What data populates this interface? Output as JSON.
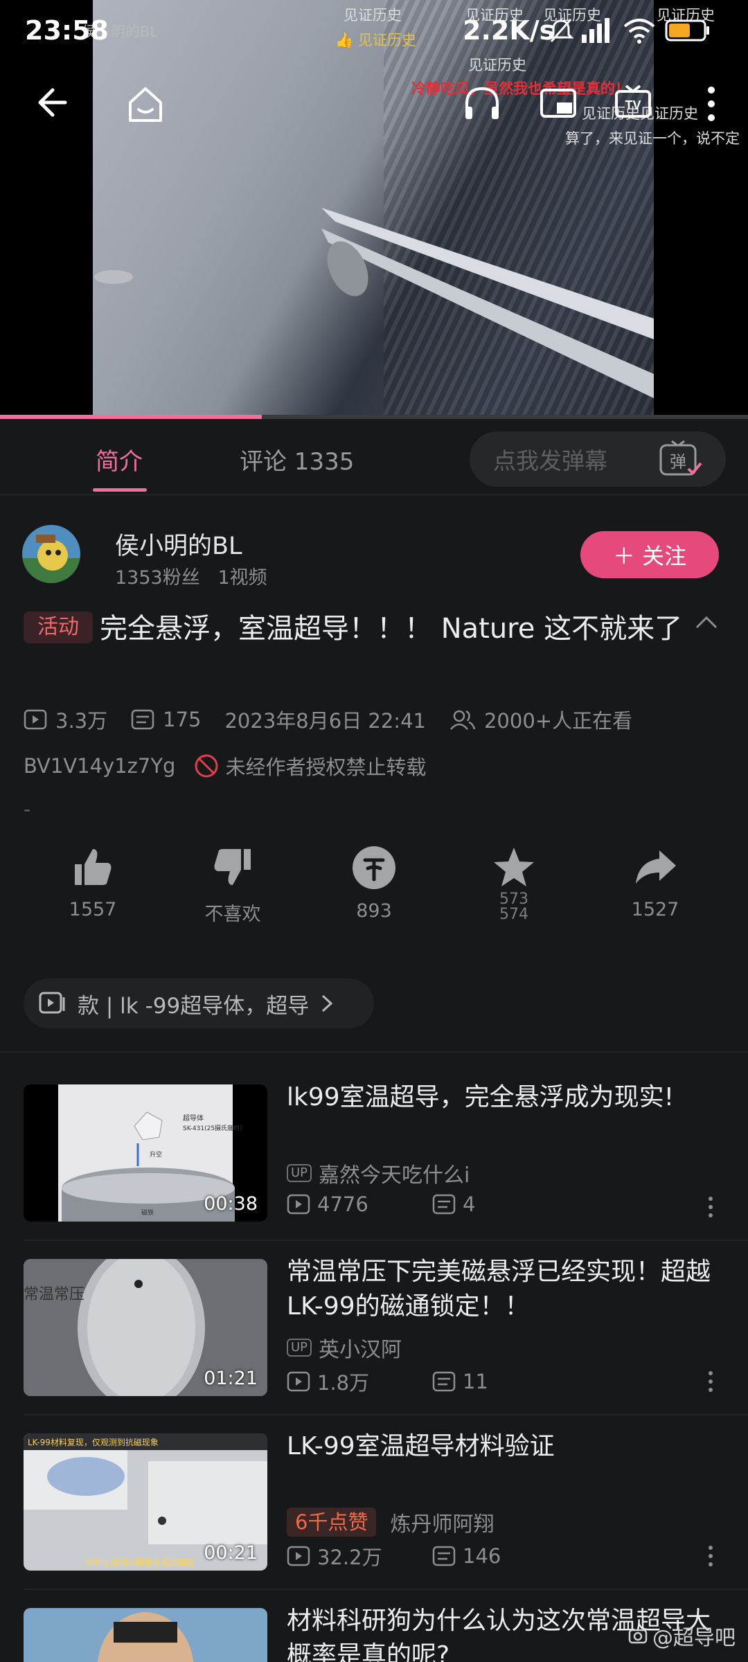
{
  "status_bar": {
    "time": "23:58",
    "network_speed": "2.2K/s"
  },
  "player": {
    "overlay_channel": "侯小明的BL",
    "danmaku": [
      "见证历史",
      "见证历史",
      "见证历史",
      "见证历史",
      "见证历史",
      "见证历史",
      "冷静吃瓜，虽然我也希望是真的！",
      "见证历史见证历史",
      "算了，来见证一个，说不定"
    ],
    "danmaku_liked": "见证历史",
    "progress": 0.35
  },
  "tabs": {
    "intro": "简介",
    "comments": "评论 1335",
    "danmu_placeholder": "点我发弹幕",
    "danmu_switch": "弹"
  },
  "author": {
    "name": "侯小明的BL",
    "fans": "1353粉丝",
    "videos": "1视频",
    "follow": "＋ 关注"
  },
  "video": {
    "tag": "活动",
    "title": "完全悬浮，室温超导！！！ Nature 这不就来了",
    "views": "3.3万",
    "danmaku_count": "175",
    "date": "2023年8月6日 22:41",
    "watching": "2000+人正在看",
    "bvid": "BV1V14y1z7Yg",
    "copyright": "未经作者授权禁止转载",
    "desc": "-"
  },
  "actions": {
    "like": "1557",
    "dislike": "不喜欢",
    "coin": "893",
    "fav_top": "573",
    "fav_bottom": "574",
    "share": "1527"
  },
  "collection": {
    "text": "款 | lk -99超导体，超导"
  },
  "related": [
    {
      "title": "lk99室温超导，完全悬浮成为现实!",
      "up": "嘉然今天吃什么i",
      "views": "4776",
      "danmaku": "4",
      "duration": "00:38"
    },
    {
      "title": "常温常压下完美磁悬浮已经实现！超越LK-99的磁通锁定！！",
      "up": "英小汉阿",
      "views": "1.8万",
      "danmaku": "11",
      "duration": "01:21"
    },
    {
      "title": "LK-99室温超导材料验证",
      "badge": "6千点赞",
      "up": "炼丹师阿翔",
      "views": "32.2万",
      "danmaku": "146",
      "duration": "00:21"
    },
    {
      "title": "材料科研狗为什么认为这次常温超导大概率是真的呢?"
    }
  ],
  "thumb_texts": {
    "t1_a": "超导体",
    "t1_b": "SK-431(25摄氏度时)",
    "t1_c": "升空",
    "t1_d": "磁铁",
    "t2": "常温常压",
    "t3_a": "LK-99材料复现，仅观测到抗磁现象",
    "t3_b": "材料太过细小摄像头无法捕捉"
  },
  "watermark": "@超导吧",
  "colors": {
    "accent": "#f0709a",
    "follow": "#e6497c",
    "background": "#17181a"
  }
}
